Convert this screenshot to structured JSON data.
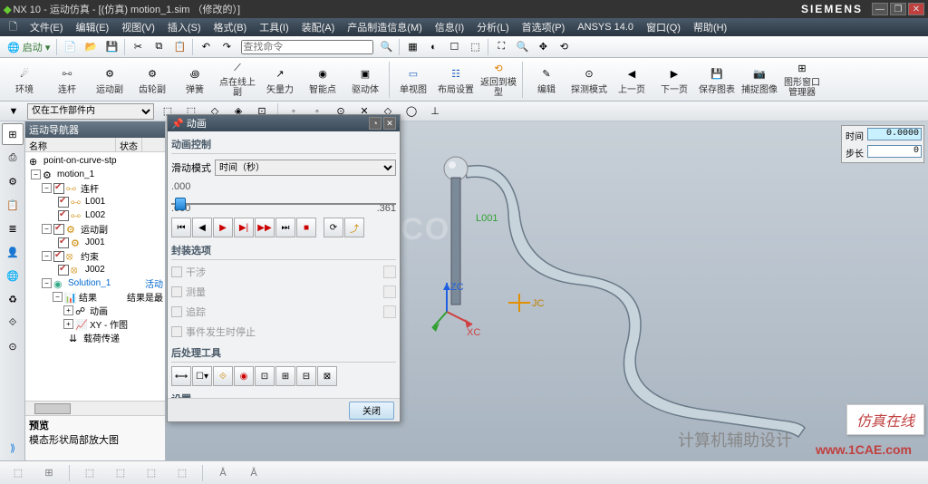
{
  "title": {
    "app": "NX 10",
    "sub": "运动仿真",
    "doc": "[(仿真) motion_1.sim （修改的）]"
  },
  "brand": "SIEMENS",
  "menu": [
    "文件(E)",
    "编辑(E)",
    "视图(V)",
    "插入(S)",
    "格式(B)",
    "工具(I)",
    "装配(A)",
    "产品制造信息(M)",
    "信息(I)",
    "分析(L)",
    "首选项(P)",
    "ANSYS 14.0",
    "窗口(Q)",
    "帮助(H)"
  ],
  "search_placeholder": "查找命令",
  "start": "启动",
  "ribbon": [
    {
      "lbl": "环境"
    },
    {
      "lbl": "连杆"
    },
    {
      "lbl": "运动副"
    },
    {
      "lbl": "齿轮副"
    },
    {
      "lbl": "弹簧"
    },
    {
      "lbl": "点在线上副"
    },
    {
      "lbl": "矢量力"
    },
    {
      "lbl": "智能点"
    },
    {
      "lbl": "驱动体"
    },
    {
      "lbl": "单视图"
    },
    {
      "lbl": "布局设置"
    },
    {
      "lbl": "返回到模型"
    },
    {
      "lbl": "编辑"
    },
    {
      "lbl": "探测模式"
    },
    {
      "lbl": "上一页"
    },
    {
      "lbl": "下一页"
    },
    {
      "lbl": "保存图表"
    },
    {
      "lbl": "捕捉图像"
    },
    {
      "lbl": "图形窗口管理器"
    }
  ],
  "filter_label": "仅在工作部件内",
  "nav": {
    "title": "运动导航器",
    "cols": {
      "name": "名称",
      "status": "状态"
    },
    "root": "point-on-curve-stp",
    "motion": "motion_1",
    "groups": [
      {
        "lbl": "连杆",
        "items": [
          "L001",
          "L002"
        ]
      },
      {
        "lbl": "运动副",
        "items": [
          "J001"
        ]
      },
      {
        "lbl": "约束",
        "items": [
          "J002"
        ]
      }
    ],
    "solution": "Solution_1",
    "solution_status": "活动",
    "results": "结果",
    "results_status": "结果是最",
    "res_items": [
      "动画",
      "XY - 作图",
      "载荷传递"
    ],
    "preview_hdr": "预览",
    "preview_txt": "模态形状局部放大图"
  },
  "dialog": {
    "title": "动画",
    "s1": "动画控制",
    "slide_mode": "滑动模式",
    "slide_sel": "时间（秒）",
    "sl_min": ".000",
    "sl_max": ".361",
    "s2": "封装选项",
    "opts": [
      "干涉",
      "测量",
      "追踪",
      "事件发生时停止"
    ],
    "s3": "后处理工具",
    "s4": "设置",
    "close": "关闭"
  },
  "time": {
    "lbl1": "时间",
    "val1": "0.0000",
    "lbl2": "步长",
    "val2": "0"
  },
  "vp": {
    "l001": "L001",
    "jc": "JC",
    "zc": "ZC",
    "xc": "XC"
  },
  "wm": "CAE.CO",
  "footer_txt": "计算机辅助设计",
  "badge": "仿真在线",
  "url": "www.1CAE.com"
}
